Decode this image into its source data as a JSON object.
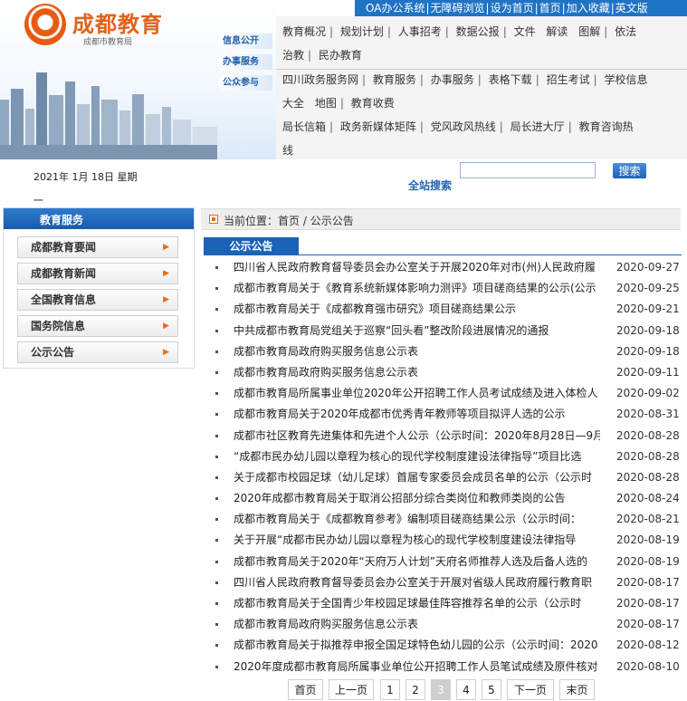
{
  "topbar": {
    "items": [
      "OA办公系统",
      "无障碍浏览",
      "设为首页",
      "首页",
      "加入收藏",
      "英文版"
    ]
  },
  "banner": {
    "title": "成都教育",
    "subtitle": "成都市教育局",
    "pills": [
      "信息公开",
      "办事服务",
      "公众参与"
    ]
  },
  "nav": {
    "line1": [
      "教育概况",
      "规划计划",
      "人事招考",
      "数据公报",
      "文件",
      "解读",
      "图解",
      "依法"
    ],
    "line1b": [
      "治教",
      "民办教育"
    ],
    "line2": [
      "四川政务服务网",
      "教育服务",
      "办事服务",
      "表格下载",
      "招生考试",
      "学校信息"
    ],
    "line2b": [
      "大全",
      "地图",
      "教育收费"
    ],
    "line3": [
      "局长信箱",
      "政务新媒体矩阵",
      "党风政风热线",
      "局长进大厅",
      "教育咨询热"
    ],
    "line3b": [
      "线"
    ]
  },
  "date_text": "2021年 1月 18日 星期一",
  "search": {
    "placeholder": "",
    "button_label": "搜索",
    "site_search_label": "全站搜索"
  },
  "sidebar": {
    "title": "教育服务",
    "items": [
      "成都教育要闻",
      "成都教育新闻",
      "全国教育信息",
      "国务院信息",
      "公示公告"
    ]
  },
  "location": {
    "prefix": "当前位置：",
    "path": "首页 / 公示公告"
  },
  "section_title": "公示公告",
  "articles": [
    {
      "title": "四川省人民政府教育督导委员会办公室关于开展2020年对市(州)人民政府履",
      "date": "2020-09-27"
    },
    {
      "title": "成都市教育局关于《教育系统新媒体影响力测评》项目磋商结果的公示(公示",
      "date": "2020-09-25"
    },
    {
      "title": "成都市教育局关于《成都教育强市研究》项目磋商结果公示",
      "date": "2020-09-21"
    },
    {
      "title": "中共成都市教育局党组关于巡察“回头看”整改阶段进展情况的通报",
      "date": "2020-09-18"
    },
    {
      "title": "成都市教育局政府购买服务信息公示表",
      "date": "2020-09-18"
    },
    {
      "title": "成都市教育局政府购买服务信息公示表",
      "date": "2020-09-11"
    },
    {
      "title": "成都市教育局所属事业单位2020年公开招聘工作人员考试成绩及进入体检人",
      "date": "2020-09-02"
    },
    {
      "title": "成都市教育局关于2020年成都市优秀青年教师等项目拟评人选的公示",
      "date": "2020-08-31"
    },
    {
      "title": "成都市社区教育先进集体和先进个人公示（公示时间：2020年8月28日—9月",
      "date": "2020-08-28"
    },
    {
      "title": "“成都市民办幼儿园以章程为核心的现代学校制度建设法律指导”项目比选",
      "date": "2020-08-28"
    },
    {
      "title": "关于成都市校园足球（幼儿足球）首届专家委员会成员名单的公示（公示时",
      "date": "2020-08-28"
    },
    {
      "title": "2020年成都市教育局关于取消公招部分综合类岗位和教师类岗的公告",
      "date": "2020-08-24"
    },
    {
      "title": "成都市教育局关于《成都教育参考》编制项目磋商结果公示（公示时间：",
      "date": "2020-08-21"
    },
    {
      "title": "关于开展“成都市民办幼儿园以章程为核心的现代学校制度建设法律指导",
      "date": "2020-08-19"
    },
    {
      "title": "成都市教育局关于2020年“天府万人计划”天府名师推荐人选及后备人选的",
      "date": "2020-08-19"
    },
    {
      "title": "四川省人民政府教育督导委员会办公室关于开展对省级人民政府履行教育职",
      "date": "2020-08-17"
    },
    {
      "title": "成都市教育局关于全国青少年校园足球最佳阵容推荐名单的公示（公示时",
      "date": "2020-08-17"
    },
    {
      "title": "成都市教育局政府购买服务信息公示表",
      "date": "2020-08-17"
    },
    {
      "title": "成都市教育局关于拟推荐申报全国足球特色幼儿园的公示（公示时间：2020",
      "date": "2020-08-12"
    },
    {
      "title": "2020年度成都市教育局所属事业单位公开招聘工作人员笔试成绩及原件核对",
      "date": "2020-08-10"
    }
  ],
  "pager": {
    "first": "首页",
    "prev": "上一页",
    "pages": [
      "1",
      "2",
      "3",
      "4",
      "5"
    ],
    "current": "3",
    "next": "下一页",
    "last": "末页"
  },
  "colors": {
    "brand_blue": "#1f73c4",
    "accent_orange": "#e86a1a"
  }
}
